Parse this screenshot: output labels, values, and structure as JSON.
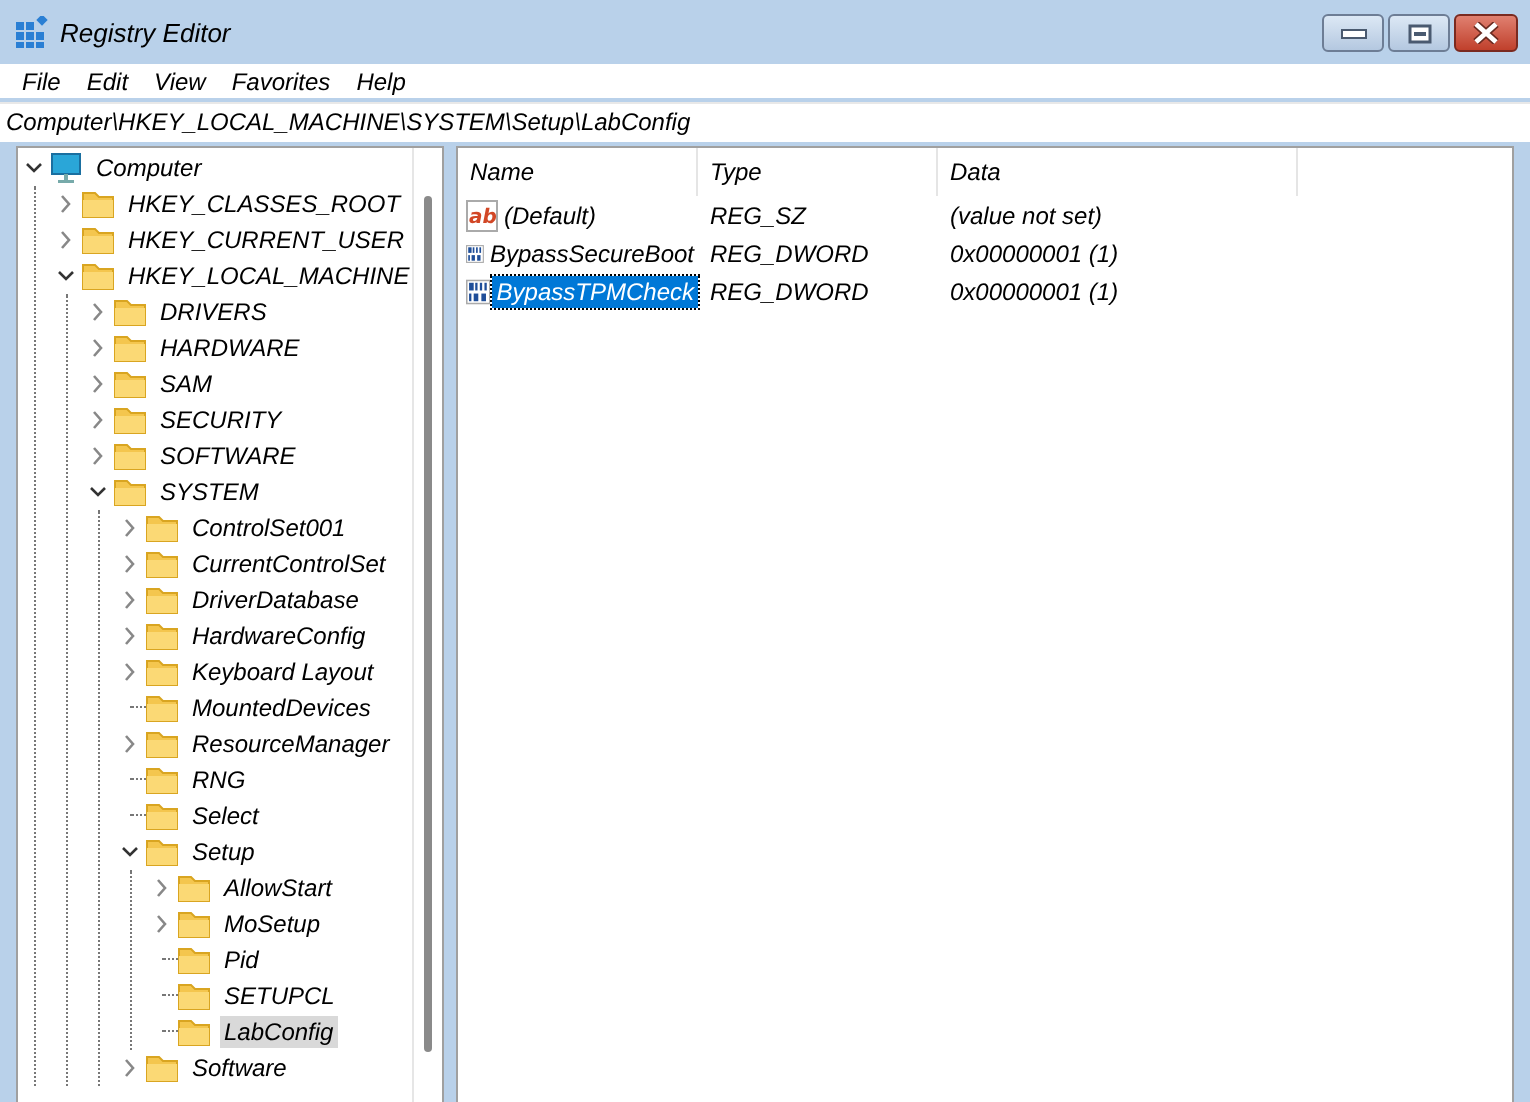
{
  "window": {
    "title": "Registry Editor"
  },
  "menu": [
    "File",
    "Edit",
    "View",
    "Favorites",
    "Help"
  ],
  "address": {
    "value": "Computer\\HKEY_LOCAL_MACHINE\\SYSTEM\\Setup\\LabConfig"
  },
  "tree": [
    {
      "label": "Computer",
      "kind": "computer",
      "expanded": true,
      "selected": false,
      "children": [
        {
          "label": "HKEY_CLASSES_ROOT",
          "kind": "key",
          "expanded": false,
          "selected": false
        },
        {
          "label": "HKEY_CURRENT_USER",
          "kind": "key",
          "expanded": false,
          "selected": false
        },
        {
          "label": "HKEY_LOCAL_MACHINE",
          "kind": "key",
          "expanded": true,
          "selected": false,
          "children": [
            {
              "label": "DRIVERS",
              "kind": "key",
              "expanded": false,
              "selected": false
            },
            {
              "label": "HARDWARE",
              "kind": "key",
              "expanded": false,
              "selected": false
            },
            {
              "label": "SAM",
              "kind": "key",
              "expanded": false,
              "selected": false
            },
            {
              "label": "SECURITY",
              "kind": "key",
              "expanded": false,
              "selected": false
            },
            {
              "label": "SOFTWARE",
              "kind": "key",
              "expanded": false,
              "selected": false
            },
            {
              "label": "SYSTEM",
              "kind": "key",
              "expanded": true,
              "selected": false,
              "children": [
                {
                  "label": "ControlSet001",
                  "kind": "key",
                  "expanded": false,
                  "selected": false
                },
                {
                  "label": "CurrentControlSet",
                  "kind": "key",
                  "expanded": false,
                  "selected": false
                },
                {
                  "label": "DriverDatabase",
                  "kind": "key",
                  "expanded": false,
                  "selected": false
                },
                {
                  "label": "HardwareConfig",
                  "kind": "key",
                  "expanded": false,
                  "selected": false
                },
                {
                  "label": "Keyboard Layout",
                  "kind": "key",
                  "expanded": false,
                  "selected": false
                },
                {
                  "label": "MountedDevices",
                  "kind": "leaf",
                  "selected": false
                },
                {
                  "label": "ResourceManager",
                  "kind": "key",
                  "expanded": false,
                  "selected": false
                },
                {
                  "label": "RNG",
                  "kind": "leaf",
                  "selected": false
                },
                {
                  "label": "Select",
                  "kind": "leaf",
                  "selected": false
                },
                {
                  "label": "Setup",
                  "kind": "key",
                  "expanded": true,
                  "selected": false,
                  "children": [
                    {
                      "label": "AllowStart",
                      "kind": "key",
                      "expanded": false,
                      "selected": false
                    },
                    {
                      "label": "MoSetup",
                      "kind": "key",
                      "expanded": false,
                      "selected": false
                    },
                    {
                      "label": "Pid",
                      "kind": "leaf",
                      "selected": false
                    },
                    {
                      "label": "SETUPCL",
                      "kind": "leaf",
                      "selected": false
                    },
                    {
                      "label": "LabConfig",
                      "kind": "leaf",
                      "selected": true
                    }
                  ]
                },
                {
                  "label": "Software",
                  "kind": "key",
                  "expanded": false,
                  "selected": false
                }
              ]
            }
          ]
        }
      ]
    }
  ],
  "values": {
    "columns": [
      "Name",
      "Type",
      "Data"
    ],
    "rows": [
      {
        "kind": "string",
        "icon_text": "ab",
        "name": "(Default)",
        "type": "REG_SZ",
        "data": "(value not set)",
        "selected": false
      },
      {
        "kind": "binary",
        "name": "BypassSecureBoot",
        "type": "REG_DWORD",
        "data": "0x00000001 (1)",
        "selected": false
      },
      {
        "kind": "binary",
        "name": "BypassTPMCheck",
        "type": "REG_DWORD",
        "data": "0x00000001 (1)",
        "selected": true
      }
    ]
  }
}
